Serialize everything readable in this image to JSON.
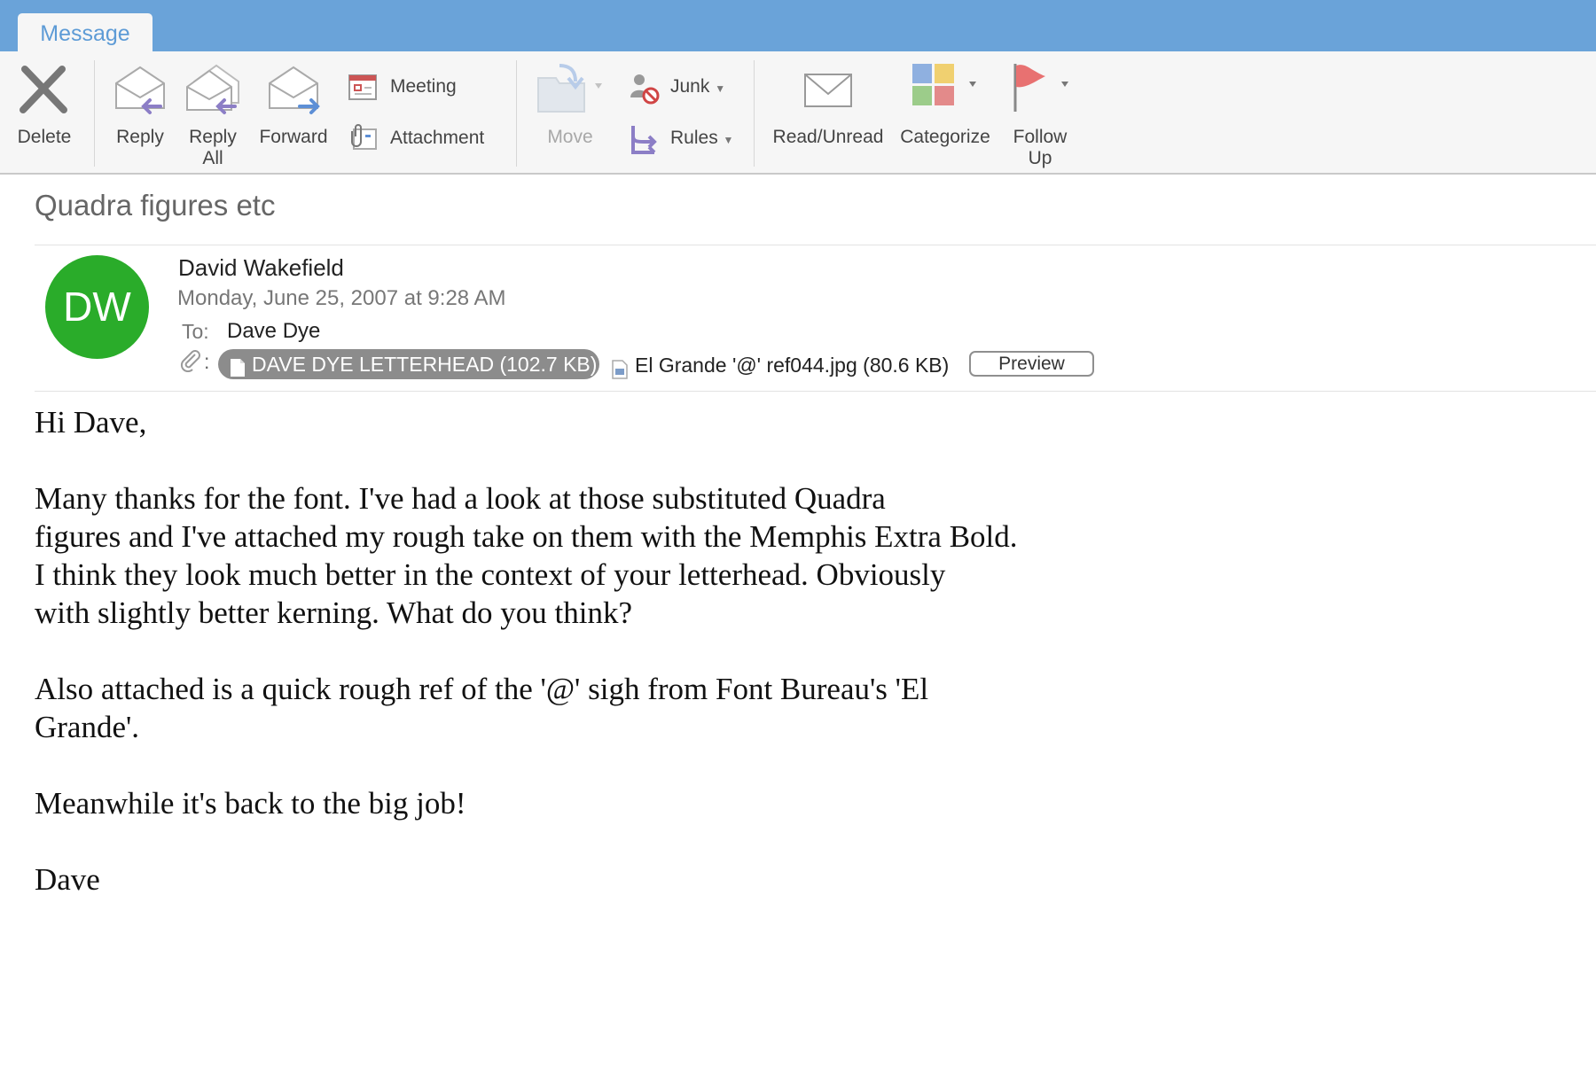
{
  "tab": {
    "label": "Message"
  },
  "ribbon": {
    "delete": "Delete",
    "reply": "Reply",
    "reply_all": [
      "Reply",
      "All"
    ],
    "forward": "Forward",
    "meeting": "Meeting",
    "attachment": "Attachment",
    "move": "Move",
    "junk": "Junk",
    "rules": "Rules",
    "read_unread": "Read/Unread",
    "categorize": "Categorize",
    "follow_up": [
      "Follow",
      "Up"
    ]
  },
  "message": {
    "subject": "Quadra figures etc",
    "avatar_initials": "DW",
    "avatar_color": "#2aac2a",
    "sender": "David Wakefield",
    "date": "Monday, June 25, 2007 at 9:28 AM",
    "to_label": "To:",
    "to": "Dave Dye",
    "attachments_colon": ":",
    "attachments": [
      {
        "label": "DAVE DYE LETTERHEAD (102.7 KB)",
        "selected": true
      },
      {
        "label": "El Grande '@' ref044.jpg (80.6 KB)",
        "selected": false
      }
    ],
    "preview_button": "Preview"
  },
  "body": {
    "paragraphs": [
      [
        "Hi Dave,"
      ],
      [
        "Many thanks for the font. I've had a look at those substituted Quadra",
        "figures and I've attached my rough take on them with the Memphis Extra Bold.",
        "I think they look much better in the context of your letterhead. Obviously",
        "with slightly better kerning. What do you think?"
      ],
      [
        "Also attached is a quick rough ref of the '@' sigh from Font Bureau's 'El",
        "Grande'."
      ],
      [
        "Meanwhile it's back to the big job!"
      ],
      [
        "Dave"
      ]
    ]
  }
}
